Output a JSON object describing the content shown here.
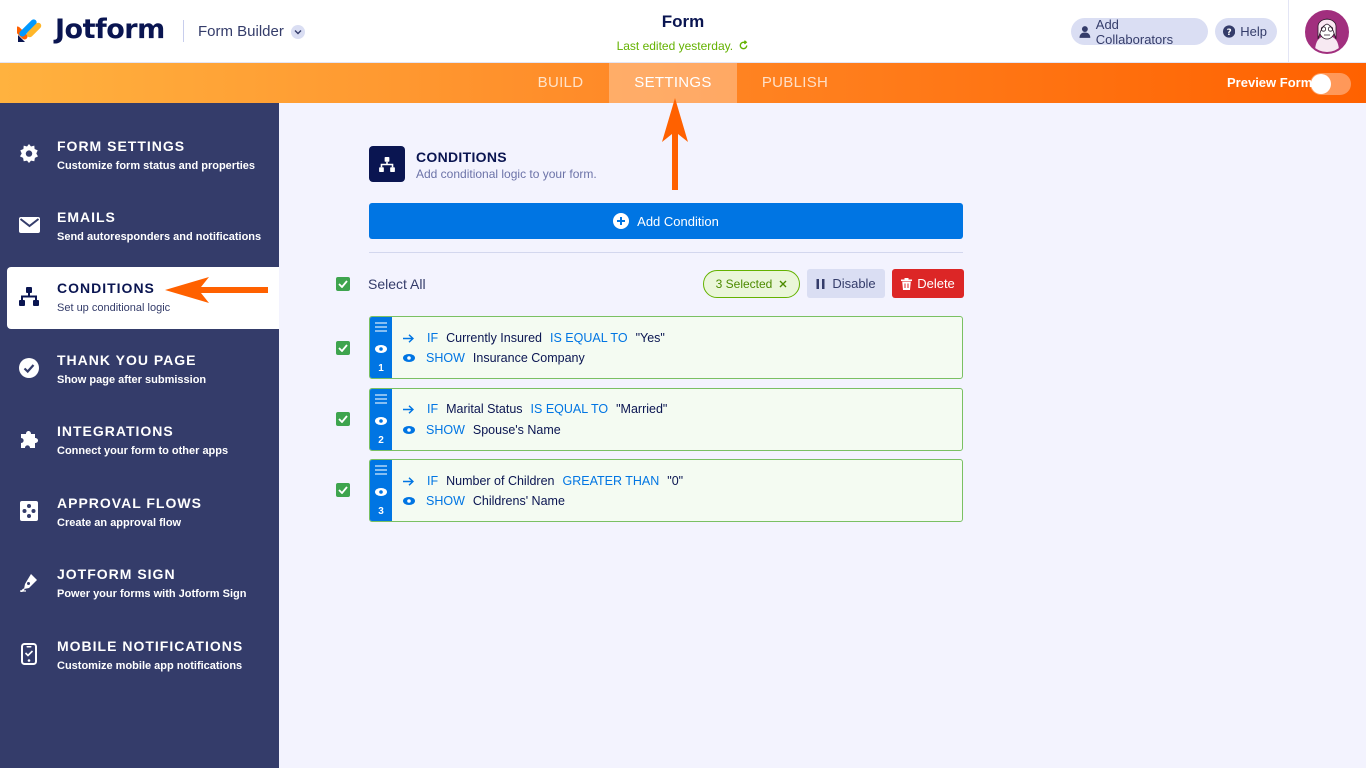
{
  "header": {
    "logo_text": "Jotform",
    "builder_label": "Form Builder",
    "form_title": "Form",
    "last_edited": "Last edited yesterday.",
    "add_collaborators": "Add Collaborators",
    "help": "Help"
  },
  "nav": {
    "tabs": [
      "BUILD",
      "SETTINGS",
      "PUBLISH"
    ],
    "active_tab": "SETTINGS",
    "preview_label": "Preview Form"
  },
  "sidebar": {
    "items": [
      {
        "title": "FORM SETTINGS",
        "subtitle": "Customize form status and properties",
        "icon": "gear-icon"
      },
      {
        "title": "EMAILS",
        "subtitle": "Send autoresponders and notifications",
        "icon": "envelope-icon"
      },
      {
        "title": "CONDITIONS",
        "subtitle": "Set up conditional logic",
        "icon": "hierarchy-icon"
      },
      {
        "title": "THANK YOU PAGE",
        "subtitle": "Show page after submission",
        "icon": "check-circle-icon"
      },
      {
        "title": "INTEGRATIONS",
        "subtitle": "Connect your form to other apps",
        "icon": "puzzle-icon"
      },
      {
        "title": "APPROVAL FLOWS",
        "subtitle": "Create an approval flow",
        "icon": "approval-icon"
      },
      {
        "title": "JOTFORM SIGN",
        "subtitle": "Power your forms with Jotform Sign",
        "icon": "pen-icon"
      },
      {
        "title": "MOBILE NOTIFICATIONS",
        "subtitle": "Customize mobile app notifications",
        "icon": "phone-icon"
      }
    ],
    "active_index": 2
  },
  "main": {
    "title": "CONDITIONS",
    "subtitle": "Add conditional logic to your form.",
    "add_condition": "Add Condition",
    "select_all": "Select All",
    "selected_count": "3 Selected",
    "disable": "Disable",
    "delete": "Delete",
    "conditions": [
      {
        "number": "1",
        "if_kw": "IF",
        "field": "Currently Insured",
        "operator": "IS EQUAL TO",
        "value": "\"Yes\"",
        "action_kw": "SHOW",
        "target": "Insurance Company"
      },
      {
        "number": "2",
        "if_kw": "IF",
        "field": "Marital Status",
        "operator": "IS EQUAL TO",
        "value": "\"Married\"",
        "action_kw": "SHOW",
        "target": "Spouse's Name"
      },
      {
        "number": "3",
        "if_kw": "IF",
        "field": "Number of Children",
        "operator": "GREATER THAN",
        "value": "\"0\"",
        "action_kw": "SHOW",
        "target": "Childrens' Name"
      }
    ]
  },
  "colors": {
    "brand_orange": "#ff6100",
    "sidebar_bg": "#343c6a",
    "accent_blue": "#0075e3",
    "check_green": "#3ea44e",
    "delete_red": "#dc2626"
  }
}
